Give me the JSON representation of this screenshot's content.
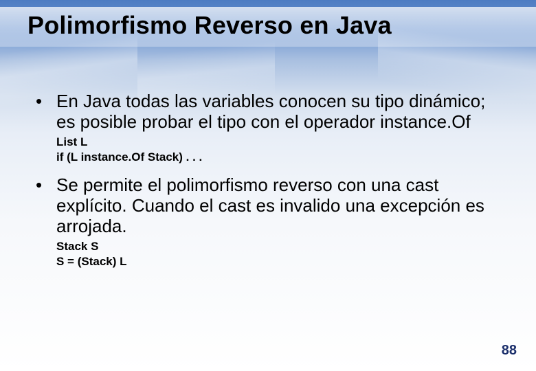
{
  "slide": {
    "title": "Polimorfismo Reverso en Java",
    "bullets": [
      {
        "text": "En Java todas las variables conocen su tipo dinámico; es posible probar el tipo con el operador instance.Of",
        "code": [
          "List L",
          "if (L instance.Of Stack) . . ."
        ]
      },
      {
        "text": "Se permite el polimorfismo reverso con una cast explícito. Cuando el cast es invalido una excepción es arrojada.",
        "code": [
          "Stack S",
          "S = (Stack) L"
        ]
      }
    ],
    "page_number": "88"
  }
}
